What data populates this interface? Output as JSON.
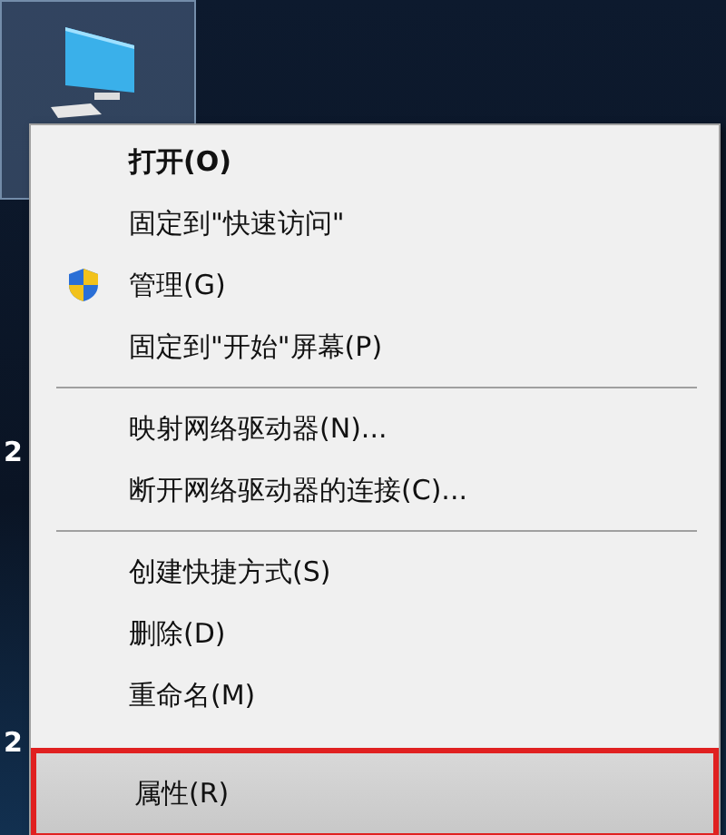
{
  "desktop": {
    "icon": {
      "kind": "computer",
      "selected": true
    },
    "labels": [
      "2",
      "2"
    ]
  },
  "context_menu": {
    "items": [
      {
        "kind": "item",
        "label": "打开(O)",
        "default": true,
        "selected": false,
        "annotated": false
      },
      {
        "kind": "item",
        "label": "固定到\"快速访问\"",
        "default": false,
        "selected": false,
        "annotated": false
      },
      {
        "kind": "admin_item",
        "label": "管理(G)",
        "default": false,
        "selected": false,
        "annotated": false
      },
      {
        "kind": "item",
        "label": "固定到\"开始\"屏幕(P)",
        "default": false,
        "selected": false,
        "annotated": false
      },
      {
        "kind": "separator"
      },
      {
        "kind": "item",
        "label": "映射网络驱动器(N)...",
        "default": false,
        "selected": false,
        "annotated": false
      },
      {
        "kind": "item",
        "label": "断开网络驱动器的连接(C)...",
        "default": false,
        "selected": false,
        "annotated": false
      },
      {
        "kind": "separator"
      },
      {
        "kind": "item",
        "label": "创建快捷方式(S)",
        "default": false,
        "selected": false,
        "annotated": false
      },
      {
        "kind": "item",
        "label": "删除(D)",
        "default": false,
        "selected": false,
        "annotated": false
      },
      {
        "kind": "item",
        "label": "重命名(M)",
        "default": false,
        "selected": false,
        "annotated": false
      },
      {
        "kind": "item",
        "label": "属性(R)",
        "default": false,
        "selected": true,
        "annotated": true
      }
    ]
  }
}
